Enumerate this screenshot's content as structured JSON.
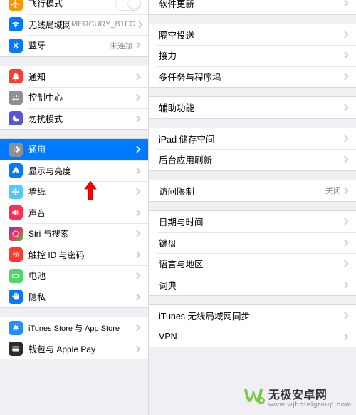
{
  "sidebar": {
    "group1": [
      {
        "name": "airplane",
        "label": "飞行模式",
        "icon": "airplane",
        "bg": "#ff9500",
        "accessory": "toggle"
      },
      {
        "name": "wifi",
        "label": "无线局域网",
        "icon": "wifi",
        "bg": "#007aff",
        "value": "MERCURY_B1FC",
        "accessory": "chev"
      },
      {
        "name": "bluetooth",
        "label": "蓝牙",
        "icon": "bluetooth",
        "bg": "#007aff",
        "value": "未连接",
        "accessory": "chev"
      }
    ],
    "group2": [
      {
        "name": "notifications",
        "label": "通知",
        "icon": "bell",
        "bg": "#ff3b30",
        "accessory": "chev"
      },
      {
        "name": "control-center",
        "label": "控制中心",
        "icon": "switches",
        "bg": "#8e8e93",
        "accessory": "chev"
      },
      {
        "name": "dnd",
        "label": "勿扰模式",
        "icon": "moon",
        "bg": "#5856d6",
        "accessory": "chev"
      }
    ],
    "group3": [
      {
        "name": "general",
        "label": "通用",
        "icon": "gear",
        "bg": "#8e8e93",
        "accessory": "chev",
        "selected": true
      },
      {
        "name": "display",
        "label": "显示与亮度",
        "icon": "text-size",
        "bg": "#007aff",
        "accessory": "chev"
      },
      {
        "name": "wallpaper",
        "label": "墙纸",
        "icon": "flower",
        "bg": "#54c7fc",
        "accessory": "chev"
      },
      {
        "name": "sounds",
        "label": "声音",
        "icon": "speaker",
        "bg": "#ff2d55",
        "accessory": "chev"
      },
      {
        "name": "siri",
        "label": "Siri 与搜索",
        "icon": "siri",
        "bg": "#1b1b2f",
        "accessory": "chev"
      },
      {
        "name": "touchid",
        "label": "触控 ID 与密码",
        "icon": "fingerprint",
        "bg": "#ff3b30",
        "accessory": "chev"
      },
      {
        "name": "battery",
        "label": "电池",
        "icon": "battery",
        "bg": "#4cd964",
        "accessory": "chev"
      },
      {
        "name": "privacy",
        "label": "隐私",
        "icon": "hand",
        "bg": "#007aff",
        "accessory": "chev"
      }
    ],
    "group4": [
      {
        "name": "itunes-store",
        "label": "iTunes Store 与 App Store",
        "icon": "appstore",
        "bg": "#1e90ff",
        "accessory": "chev"
      },
      {
        "name": "wallet",
        "label": "钱包与 Apple Pay",
        "icon": "wallet",
        "bg": "#2b2b2b",
        "accessory": "chev"
      }
    ]
  },
  "detail": {
    "group1": [
      {
        "name": "software-update",
        "label": "软件更新"
      }
    ],
    "group2": [
      {
        "name": "airdrop",
        "label": "隔空投送"
      },
      {
        "name": "handoff",
        "label": "接力"
      },
      {
        "name": "multitasking",
        "label": "多任务与程序坞"
      }
    ],
    "group3": [
      {
        "name": "accessibility",
        "label": "辅助功能"
      }
    ],
    "group4": [
      {
        "name": "storage",
        "label": "iPad 储存空间"
      },
      {
        "name": "background-refresh",
        "label": "后台应用刷新"
      }
    ],
    "group5": [
      {
        "name": "restrictions",
        "label": "访问限制",
        "value": "关闭"
      }
    ],
    "group6": [
      {
        "name": "date-time",
        "label": "日期与时间"
      },
      {
        "name": "keyboard",
        "label": "键盘"
      },
      {
        "name": "language",
        "label": "语言与地区"
      },
      {
        "name": "dictionary",
        "label": "词典"
      }
    ],
    "group7": [
      {
        "name": "itunes-wifi-sync",
        "label": "iTunes 无线局域网同步"
      },
      {
        "name": "vpn",
        "label": "VPN"
      }
    ]
  },
  "watermark": {
    "brand": "无极安卓网",
    "url": "www.wjhotelgroup.com"
  }
}
